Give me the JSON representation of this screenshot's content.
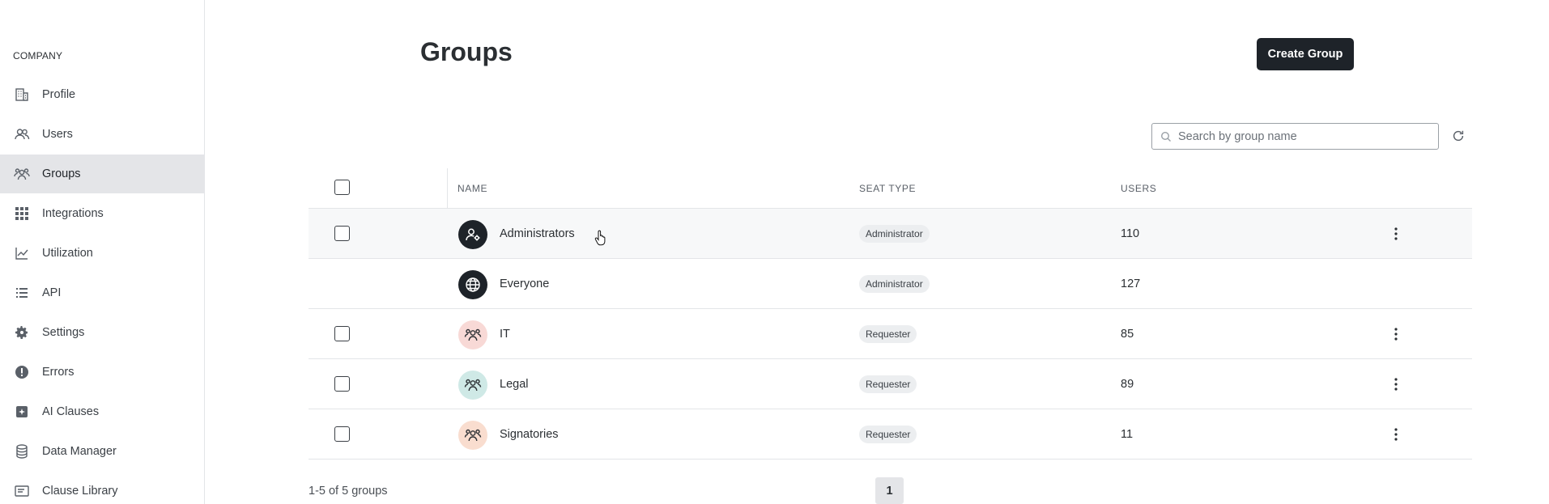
{
  "sidebar": {
    "section_label": "COMPANY",
    "items": [
      {
        "label": "Profile",
        "icon": "building-icon"
      },
      {
        "label": "Users",
        "icon": "users-icon"
      },
      {
        "label": "Groups",
        "icon": "groups-icon",
        "active": true
      },
      {
        "label": "Integrations",
        "icon": "grid-icon"
      },
      {
        "label": "Utilization",
        "icon": "chart-line-icon"
      },
      {
        "label": "API",
        "icon": "list-icon"
      },
      {
        "label": "Settings",
        "icon": "gear-icon"
      },
      {
        "label": "Errors",
        "icon": "alert-icon"
      },
      {
        "label": "AI Clauses",
        "icon": "ai-plus-icon"
      },
      {
        "label": "Data Manager",
        "icon": "database-icon"
      },
      {
        "label": "Clause Library",
        "icon": "library-icon"
      }
    ]
  },
  "header": {
    "title": "Groups",
    "create_label": "Create Group"
  },
  "search": {
    "placeholder": "Search by group name",
    "value": ""
  },
  "table": {
    "columns": [
      "NAME",
      "SEAT TYPE",
      "USERS"
    ],
    "rows": [
      {
        "name": "Administrators",
        "seat_type": "Administrator",
        "users": "110",
        "avatar": "user-gear-icon",
        "avatar_bg": "#1e2329",
        "has_checkbox": true,
        "has_menu": true
      },
      {
        "name": "Everyone",
        "seat_type": "Administrator",
        "users": "127",
        "avatar": "globe-icon",
        "avatar_bg": "#1e2329",
        "has_checkbox": false,
        "has_menu": false
      },
      {
        "name": "IT",
        "seat_type": "Requester",
        "users": "85",
        "avatar": "group-icon",
        "avatar_bg": "#f8d9d6",
        "has_checkbox": true,
        "has_menu": true
      },
      {
        "name": "Legal",
        "seat_type": "Requester",
        "users": "89",
        "avatar": "group-icon",
        "avatar_bg": "#cfe9e6",
        "has_checkbox": true,
        "has_menu": true
      },
      {
        "name": "Signatories",
        "seat_type": "Requester",
        "users": "11",
        "avatar": "group-icon",
        "avatar_bg": "#f9ddcf",
        "has_checkbox": true,
        "has_menu": true
      }
    ]
  },
  "pagination": {
    "summary": "1-5 of 5 groups",
    "current_page": "1"
  }
}
